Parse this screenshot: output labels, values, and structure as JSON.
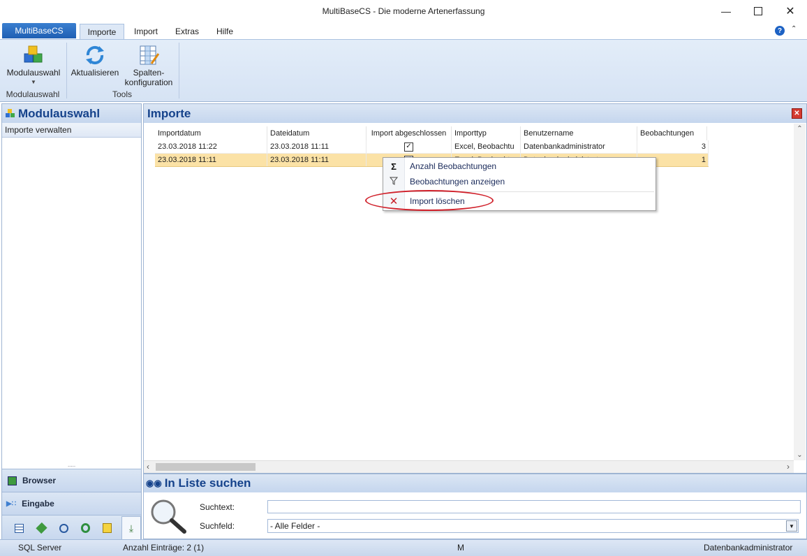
{
  "window": {
    "title": "MultiBaseCS - Die moderne Artenerfassung"
  },
  "ribbon": {
    "app_tab": "MultiBaseCS",
    "tabs": [
      "Importe",
      "Import",
      "Extras",
      "Hilfe"
    ],
    "buttons": {
      "modulauswahl": "Modulauswahl",
      "aktualisieren": "Aktualisieren",
      "spalten_line1": "Spalten-",
      "spalten_line2": "konfiguration"
    },
    "groups": {
      "modulauswahl": "Modulauswahl",
      "tools": "Tools"
    }
  },
  "left_panel": {
    "title": "Modulauswahl",
    "items": [
      "Importe verwalten"
    ],
    "nav": {
      "browser": "Browser",
      "eingabe": "Eingabe"
    }
  },
  "main": {
    "title": "Importe",
    "columns": [
      "Importdatum",
      "Dateidatum",
      "Import abgeschlossen",
      "Importtyp",
      "Benutzername",
      "Beobachtungen"
    ],
    "rows": [
      {
        "importdatum": "23.03.2018 11:22",
        "dateidatum": "23.03.2018 11:11",
        "abgeschlossen": true,
        "importtyp": "Excel, Beobachtu",
        "benutzer": "Datenbankadministrator",
        "beobachtungen": "3"
      },
      {
        "importdatum": "23.03.2018 11:11",
        "dateidatum": "23.03.2018 11:11",
        "abgeschlossen": true,
        "importtyp": "Excel, Beobachtu",
        "benutzer": "Datenbankadministrator",
        "beobachtungen": "1"
      }
    ]
  },
  "context_menu": {
    "items": [
      "Anzahl Beobachtungen",
      "Beobachtungen anzeigen",
      "Import löschen"
    ]
  },
  "search": {
    "title": "In Liste suchen",
    "suchtext_label": "Suchtext:",
    "suchtext_value": "",
    "suchfeld_label": "Suchfeld:",
    "suchfeld_value": "- Alle Felder -"
  },
  "status": {
    "server": "SQL Server",
    "count": "Anzahl Einträge: 2 (1)",
    "mid": "M",
    "user": "Datenbankadministrator"
  },
  "colors": {
    "accent": "#1f5fb3",
    "header_text": "#15428b",
    "selected_row": "#fbe2a6",
    "highlight_ring": "#d0202a"
  }
}
